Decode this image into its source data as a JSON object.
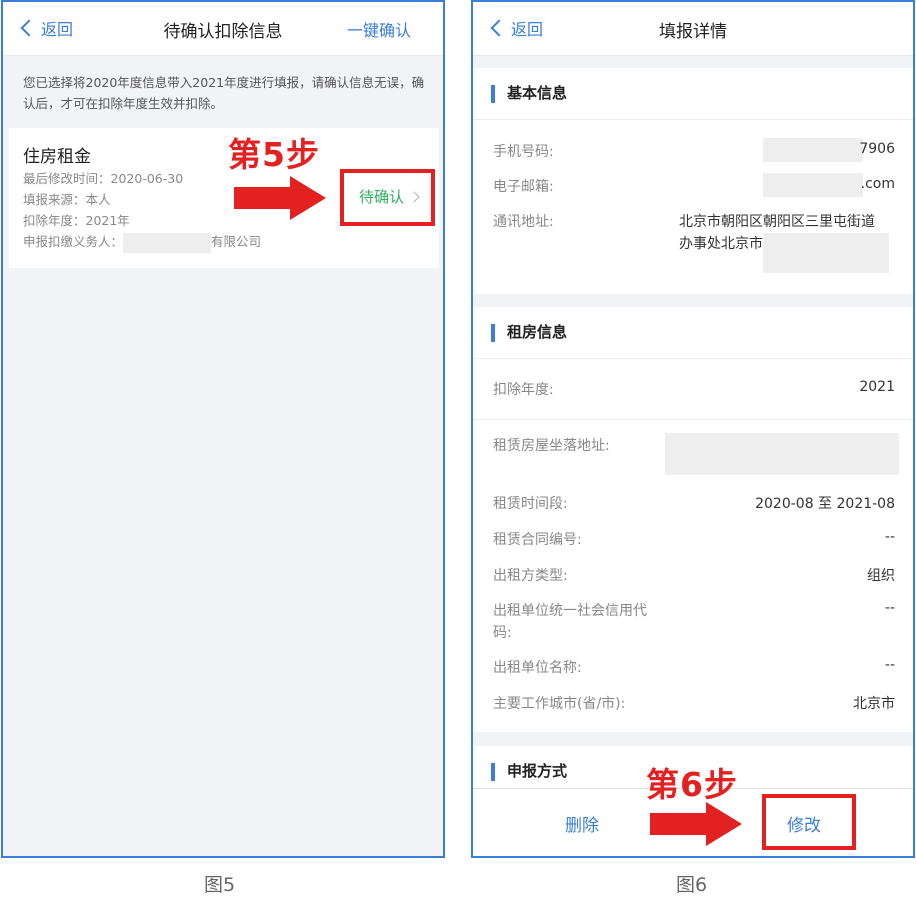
{
  "screen5": {
    "back_label": "返回",
    "title": "待确认扣除信息",
    "confirm_all": "一键确认",
    "notice": "您已选择将2020年度信息带入2021年度进行填报，请确认信息无误，确认后，才可在扣除年度生效并扣除。",
    "card": {
      "title": "住房租金",
      "last_modified": "最后修改时间：2020-06-30",
      "source": "填报来源：本人",
      "year": "扣除年度：2021年",
      "withholder_prefix": "申报扣缴义务人：",
      "withholder_suffix": "有限公司",
      "status": "待确认"
    },
    "step_label": "第5步",
    "caption": "图5"
  },
  "screen6": {
    "back_label": "返回",
    "title": "填报详情",
    "basic": {
      "title": "基本信息",
      "phone_label": "手机号码:",
      "phone_value": "7906",
      "email_label": "电子邮箱:",
      "email_value": ".com",
      "address_label": "通讯地址:",
      "address_line1": "北京市朝阳区朝阳区三里屯街道",
      "address_line2": "办事处北京市"
    },
    "rent": {
      "title": "租房信息",
      "year_label": "扣除年度:",
      "year_value": "2021",
      "location_label": "租赁房屋坐落地址:",
      "period_label": "租赁时间段:",
      "period_value": "2020-08 至 2021-08",
      "contract_label": "租赁合同编号:",
      "contract_value": "--",
      "landlord_type_label": "出租方类型:",
      "landlord_type_value": "组织",
      "credit_code_label1": "出租单位统一社会信用代",
      "credit_code_label2": "码:",
      "credit_code_value": "--",
      "landlord_name_label": "出租单位名称:",
      "landlord_name_value": "--",
      "city_label": "主要工作城市(省/市):",
      "city_value": "北京市"
    },
    "declare": {
      "title": "申报方式"
    },
    "delete_label": "删除",
    "modify_label": "修改",
    "step_label": "第6步",
    "caption": "图6"
  },
  "colors": {
    "accent": "#3a7fd5",
    "step_red": "#e42121",
    "pending_green": "#2fae5e"
  }
}
